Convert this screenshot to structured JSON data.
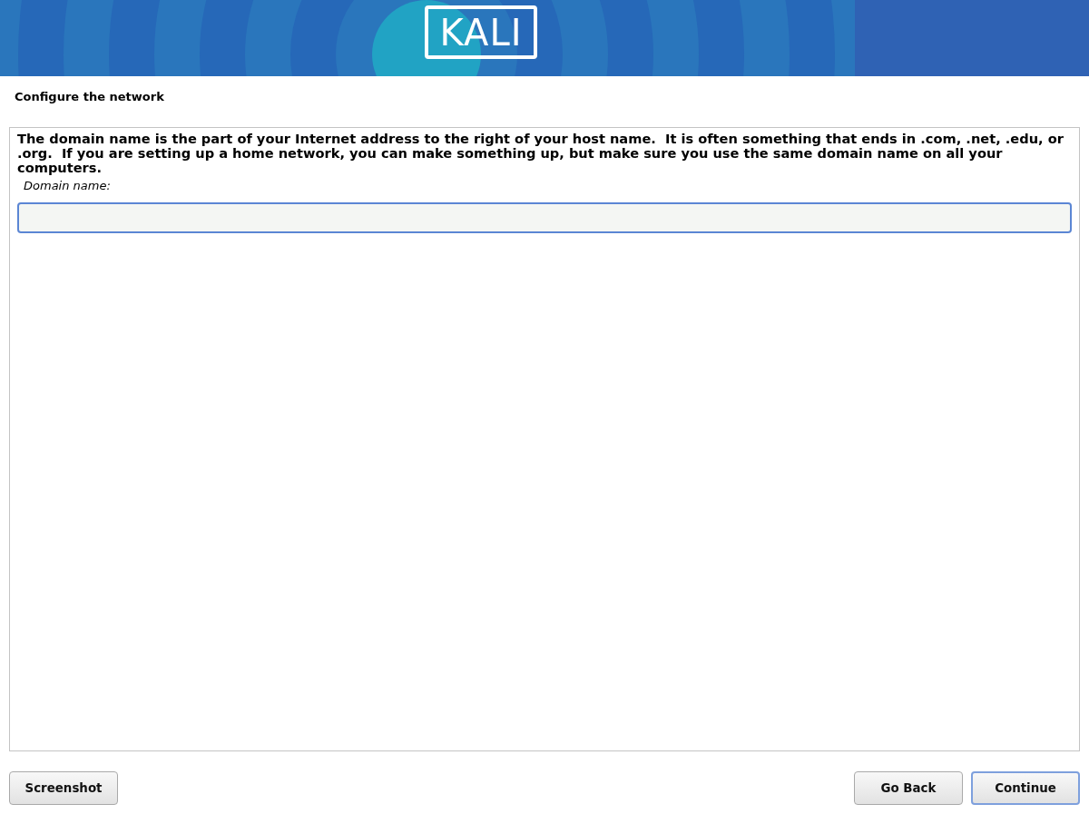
{
  "banner": {
    "logo": "KALI"
  },
  "title": "Configure the network",
  "description": "The domain name is the part of your Internet address to the right of your host name.  It is often something that ends in .com, .net, .edu, or .org.  If you are setting up a home network, you can make something up, but make sure you use the same domain name on all your computers.",
  "field": {
    "label": "Domain name:",
    "focused": true
  },
  "left_buttons": [
    {
      "label": "Screenshot",
      "default": false
    }
  ],
  "right_buttons": [
    {
      "label": "Go Back",
      "default": false
    },
    {
      "label": "Continue",
      "default": true
    }
  ]
}
